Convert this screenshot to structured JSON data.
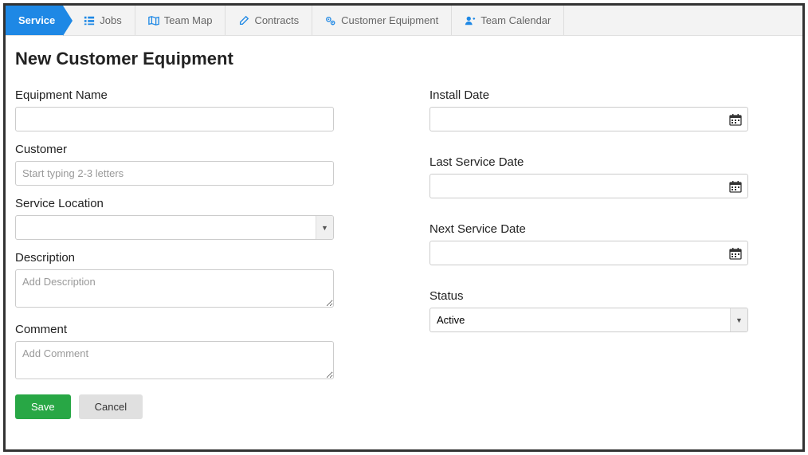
{
  "nav": {
    "active": "Service",
    "items": [
      {
        "label": "Jobs",
        "icon": "list-icon"
      },
      {
        "label": "Team Map",
        "icon": "map-icon"
      },
      {
        "label": "Contracts",
        "icon": "edit-icon"
      },
      {
        "label": "Customer Equipment",
        "icon": "gears-icon"
      },
      {
        "label": "Team Calendar",
        "icon": "user-plus-icon"
      }
    ]
  },
  "page": {
    "title": "New Customer Equipment"
  },
  "fields": {
    "equipment_name": {
      "label": "Equipment Name",
      "value": ""
    },
    "customer": {
      "label": "Customer",
      "placeholder": "Start typing 2-3 letters",
      "value": ""
    },
    "service_location": {
      "label": "Service Location",
      "value": ""
    },
    "description": {
      "label": "Description",
      "placeholder": "Add Description",
      "value": ""
    },
    "comment": {
      "label": "Comment",
      "placeholder": "Add Comment",
      "value": ""
    },
    "install_date": {
      "label": "Install Date",
      "value": ""
    },
    "last_service_date": {
      "label": "Last Service Date",
      "value": ""
    },
    "next_service_date": {
      "label": "Next Service Date",
      "value": ""
    },
    "status": {
      "label": "Status",
      "value": "Active"
    }
  },
  "buttons": {
    "save": "Save",
    "cancel": "Cancel"
  }
}
